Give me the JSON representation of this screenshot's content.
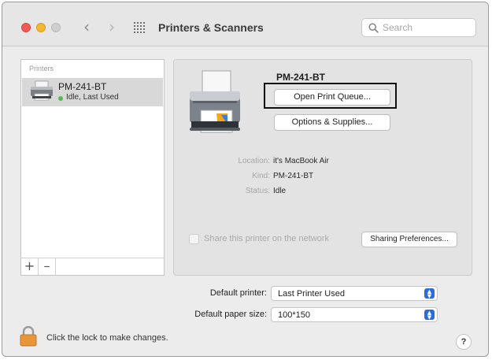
{
  "window": {
    "title": "Printers & Scanners",
    "nav_back": "‹",
    "nav_forward": "›"
  },
  "search": {
    "placeholder": "Search",
    "value": ""
  },
  "printer_list": {
    "header": "Printers",
    "items": [
      {
        "name": "PM-241-BT",
        "status": "Idle, Last Used",
        "status_color": "#4fbf4a"
      }
    ],
    "add_label": "+",
    "remove_label": "–"
  },
  "details": {
    "name": "PM-241-BT",
    "open_queue_label": "Open Print Queue...",
    "options_label": "Options & Supplies...",
    "location_label": "Location:",
    "location_value": "it's MacBook Air",
    "kind_label": "Kind:",
    "kind_value": "PM-241-BT",
    "status_label": "Status:",
    "status_value": "Idle",
    "share_label": "Share this printer on the network",
    "sharing_prefs_label": "Sharing Preferences..."
  },
  "settings": {
    "default_printer_label": "Default printer:",
    "default_printer_value": "Last Printer Used",
    "paper_size_label": "Default paper size:",
    "paper_size_value": "100*150"
  },
  "lock": {
    "text": "Click the lock to make changes."
  },
  "help_label": "?",
  "colors": {
    "accent": "#2a6be0",
    "close": "#ee5b52",
    "minimize": "#f2b631",
    "zoom_disabled": "#cfcfcf",
    "lock": "#e8963a"
  }
}
